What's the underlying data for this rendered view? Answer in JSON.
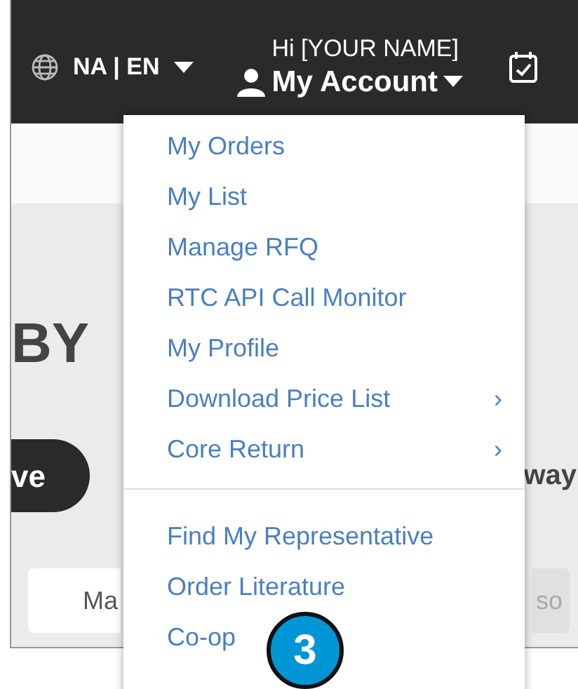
{
  "header": {
    "region_selector": "NA | EN",
    "greeting": "Hi [YOUR NAME]",
    "account_label": "My Account"
  },
  "account_menu": {
    "groups": [
      [
        {
          "label": "My Orders"
        },
        {
          "label": "My List"
        },
        {
          "label": "Manage RFQ"
        },
        {
          "label": "RTC API Call Monitor"
        },
        {
          "label": "My Profile"
        },
        {
          "label": "Download Price List",
          "arrow": "›"
        },
        {
          "label": "Core Return",
          "arrow": "›"
        }
      ],
      [
        {
          "label": "Find My Representative"
        },
        {
          "label": "Order Literature"
        },
        {
          "label": "Co-op"
        }
      ]
    ]
  },
  "page": {
    "heading": "BY",
    "pill_button": "ve",
    "side_text": "way",
    "buttons": [
      "Ma",
      "so"
    ]
  },
  "callout": "3"
}
